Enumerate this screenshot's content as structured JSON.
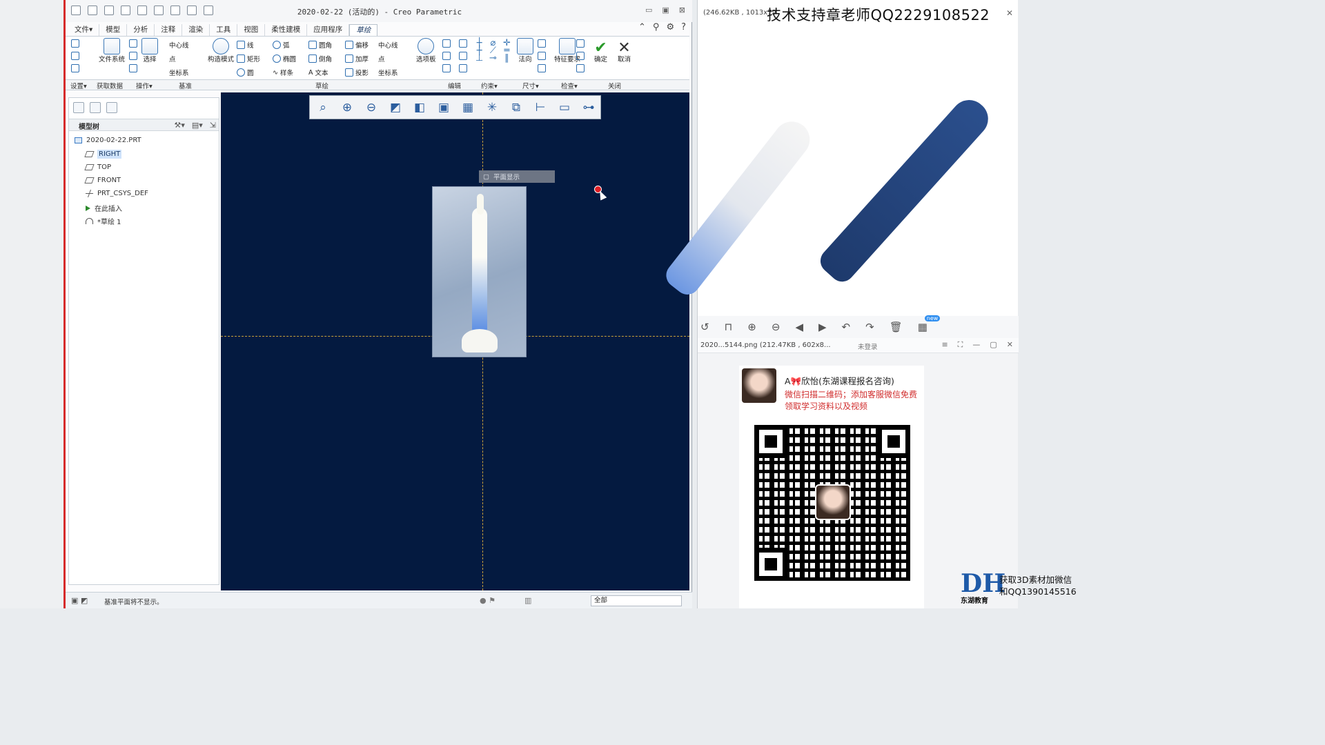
{
  "window": {
    "title": "2020-02-22 (活动的) - Creo Parametric",
    "controls": [
      "▭",
      "▣",
      "⊠"
    ]
  },
  "ribbon": {
    "tabs": [
      "文件▾",
      "模型",
      "分析",
      "注释",
      "渲染",
      "工具",
      "视图",
      "柔性建模",
      "应用程序",
      "草绘"
    ],
    "active_tab": "草绘",
    "buttons": {
      "file_system": "文件系统",
      "select": "选择",
      "construct_mode": "构造模式",
      "centerline": "中心线",
      "point": "点",
      "csys": "坐标系",
      "line": "线",
      "arc": "弧",
      "fillet": "圆角",
      "offset": "偏移",
      "centerline2": "中心线",
      "rectangle": "矩形",
      "ellipse": "椭圆",
      "chamfer": "倒角",
      "thicken": "加厚",
      "point2": "点",
      "circle": "圆",
      "spline": "样条",
      "text": "文本",
      "project": "投影",
      "csys2": "坐标系",
      "palette": "选项板",
      "normal": "法向",
      "feature_requirements": "特征要求",
      "ok": "确定",
      "cancel": "取消"
    },
    "groups": [
      "设置▾",
      "获取数据",
      "操作▾",
      "基准",
      "草绘",
      "编辑",
      "约束▾",
      "尺寸▾",
      "检查▾",
      "关闭"
    ]
  },
  "model_tree": {
    "title": "模型树",
    "items": [
      {
        "label": "2020-02-22.PRT",
        "icon": "part-icon"
      },
      {
        "label": "RIGHT",
        "icon": "datum-plane-icon",
        "selected": true
      },
      {
        "label": "TOP",
        "icon": "datum-plane-icon"
      },
      {
        "label": "FRONT",
        "icon": "datum-plane-icon"
      },
      {
        "label": "PRT_CSYS_DEF",
        "icon": "csys-icon"
      },
      {
        "label": "在此插入",
        "icon": "insert-arrow-icon"
      },
      {
        "label": "*草绘 1",
        "icon": "sketch-icon"
      }
    ]
  },
  "viewport": {
    "popup": "平面显示",
    "toolbar_icons": [
      "refit-icon",
      "zoom-in-icon",
      "zoom-out-icon",
      "repaint-icon",
      "display-style-icon",
      "saved-views-icon",
      "sketch-view-icon",
      "datum-display-icon",
      "display-icon",
      "dimension-display-icon",
      "constraint-display-icon",
      "grid-display-icon",
      "vertex-display-icon"
    ]
  },
  "status": {
    "message": "基准平面将不显示。",
    "filter": "全部"
  },
  "viewer_top": {
    "info": "(246.62KB , 1013x79",
    "watermark": "技术支持章老师QQ2229108522",
    "toolbar_icons": [
      "rotate-left-icon",
      "crop-icon",
      "zoom-in-icon",
      "zoom-out-icon",
      "prev-icon",
      "next-icon",
      "undo-icon",
      "redo-icon",
      "delete-icon",
      "new-icon"
    ],
    "new_badge": "new"
  },
  "viewer_bottom": {
    "file": "2020...5144.png (212.47KB , 602x8...",
    "login": "未登录",
    "controls": [
      "≡",
      "⛶",
      "—",
      "▢",
      "✕"
    ]
  },
  "card": {
    "name": "A🎀欣怡(东湖课程报名咨询)",
    "desc": "微信扫描二维码；添加客服微信免费领取学习资料以及视频"
  },
  "promo": {
    "logo_text": "东湖教育",
    "line1": "获取3D素材加微信",
    "line2": "和QQ1390145516"
  }
}
